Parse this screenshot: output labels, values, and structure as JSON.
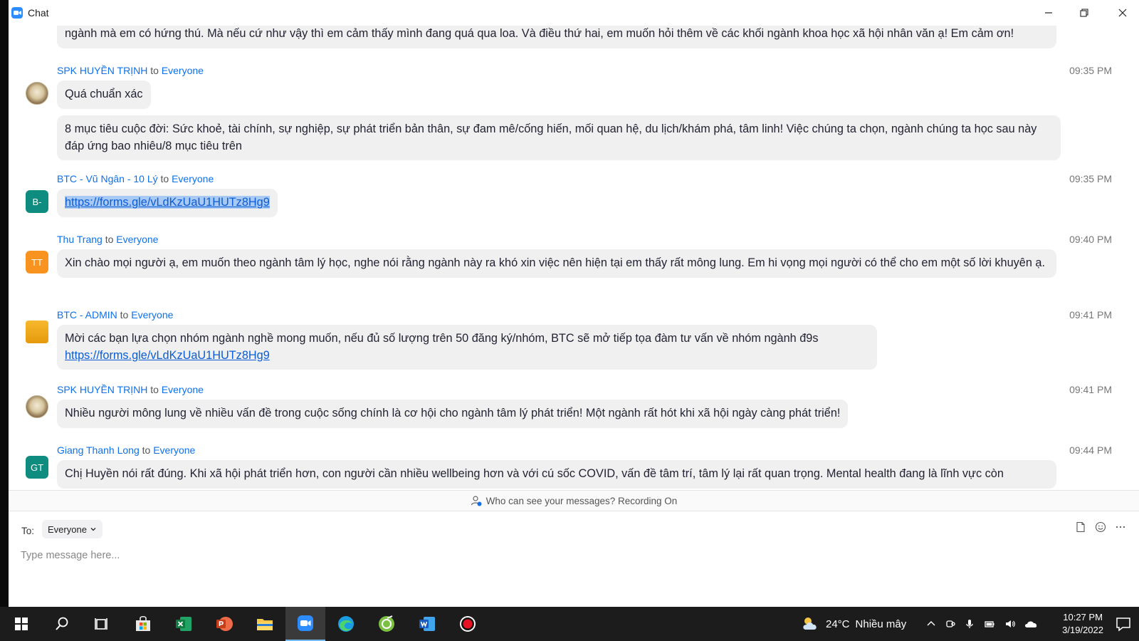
{
  "window": {
    "title": "Chat",
    "minimize_label": "Minimize",
    "restore_label": "Restore",
    "close_label": "Close"
  },
  "messages": [
    {
      "bubbles": [
        {
          "text": "ngành mà em có hứng thú. Mà nếu cứ như vậy thì em cảm thấy mình đang quá qua loa. Và điều thứ hai, em muốn hỏi thêm về các khối ngành khoa học xã hội nhân văn ạ! Em cảm ơn!"
        }
      ]
    },
    {
      "sender": "SPK HUYỀN TRỊNH",
      "to_word": "to",
      "recipient": "Everyone",
      "time": "09:35 PM",
      "avatar_icon": "photo-avatar",
      "bubbles": [
        {
          "text": "Quá chuẩn xác"
        },
        {
          "text": "8 mục tiêu cuộc đời: Sức khoẻ, tài chính, sự nghiệp, sự phát triển bản thân, sự đam mê/cống hiến, mối quan hệ, du lịch/khám phá, tâm linh! Việc chúng ta chọn, ngành chúng ta học sau này đáp ứng bao nhiêu/8 mục tiêu trên"
        }
      ]
    },
    {
      "sender": "BTC - Vũ Ngân - 10 Lý",
      "to_word": "to",
      "recipient": "Everyone",
      "time": "09:35 PM",
      "avatar_text": "B-",
      "avatar_color": "#0E8C7F",
      "bubbles": [
        {
          "link": "https://forms.gle/vLdKzUaU1HUTz8Hg9"
        }
      ]
    },
    {
      "sender": "Thu Trang",
      "to_word": "to",
      "recipient": "Everyone",
      "time": "09:40 PM",
      "avatar_text": "TT",
      "avatar_color": "#F7931E",
      "bubbles": [
        {
          "text": "Xin chào mọi người ạ, em muốn theo ngành tâm lý học, nghe nói rằng ngành này ra khó xin việc nên hiện tại em thấy rất mông lung. Em hi vọng mọi người có thể cho em một số lời khuyên ạ."
        }
      ]
    },
    {
      "sender": "BTC - ADMIN",
      "to_word": "to",
      "recipient": "Everyone",
      "time": "09:41 PM",
      "avatar_icon": "logo-avatar",
      "bubbles": [
        {
          "text": "Mời các bạn lựa chọn nhóm ngành nghề mong muốn, nếu đủ số lượng trên 50 đăng ký/nhóm, BTC sẽ mở tiếp tọa đàm tư vấn về nhóm ngành đ9s",
          "link": "https://forms.gle/vLdKzUaU1HUTz8Hg9"
        }
      ]
    },
    {
      "sender": "SPK HUYỀN TRỊNH",
      "to_word": "to",
      "recipient": "Everyone",
      "time": "09:41 PM",
      "avatar_icon": "photo-avatar",
      "bubbles": [
        {
          "text": "Nhiều người mông lung về nhiều vấn đề trong cuộc sống chính là cơ hội cho ngành tâm lý phát triển! Một ngành rất hót khi xã hội ngày càng phát triển!"
        }
      ]
    },
    {
      "sender": "Giang Thanh Long",
      "to_word": "to",
      "recipient": "Everyone",
      "time": "09:44 PM",
      "avatar_text": "GT",
      "avatar_color": "#0E8C7F",
      "bubbles": [
        {
          "text": "Chị Huyền nói rất đúng. Khi xã hội phát triển hơn, con người cần nhiều wellbeing hơn và với cú sốc COVID, vấn đề tâm trí, tâm lý lại rất quan trọng. Mental health đang là lĩnh vực còn"
        }
      ]
    }
  ],
  "privacy_notice": "Who can see your messages? Recording On",
  "compose": {
    "to_label": "To:",
    "recipient": "Everyone",
    "placeholder": "Type message here...",
    "icons": [
      "file-icon",
      "emoji-icon",
      "more-icon"
    ]
  },
  "taskbar": {
    "apps": [
      "windows-start-icon",
      "search-icon",
      "task-view-icon",
      "microsoft-store-icon",
      "excel-icon",
      "powerpoint-icon",
      "file-explorer-icon",
      "zoom-icon",
      "edge-icon",
      "greenshot-icon",
      "word-icon",
      "record-icon"
    ],
    "weather": {
      "temp": "24°C",
      "condition": "Nhiều mây"
    },
    "time": "10:27 PM",
    "date": "3/19/2022"
  }
}
